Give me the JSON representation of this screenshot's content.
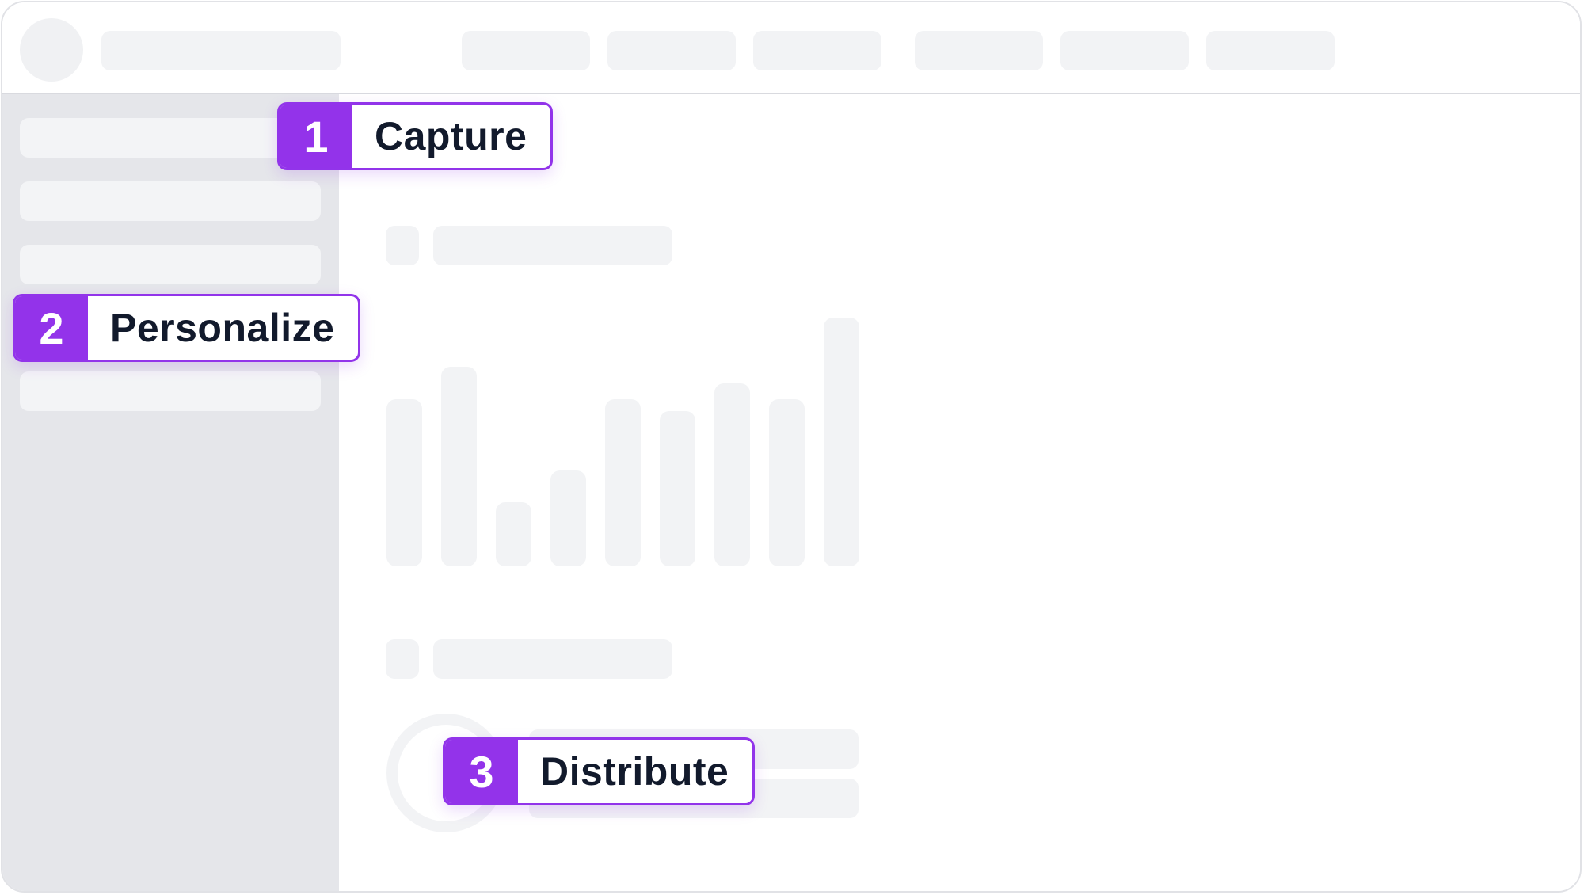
{
  "steps": [
    {
      "number": "1",
      "label": "Capture"
    },
    {
      "number": "2",
      "label": "Personalize"
    },
    {
      "number": "3",
      "label": "Distribute"
    }
  ],
  "colors": {
    "accent": "#9333ea",
    "label_text": "#121a2c",
    "skeleton": "#f2f3f5",
    "sidebar_bg": "#e5e6ea"
  },
  "chart_data": {
    "type": "bar",
    "categories": [
      "",
      "",
      "",
      "",
      "",
      "",
      "",
      "",
      ""
    ],
    "values": [
      210,
      250,
      80,
      120,
      210,
      195,
      230,
      210,
      312
    ]
  }
}
